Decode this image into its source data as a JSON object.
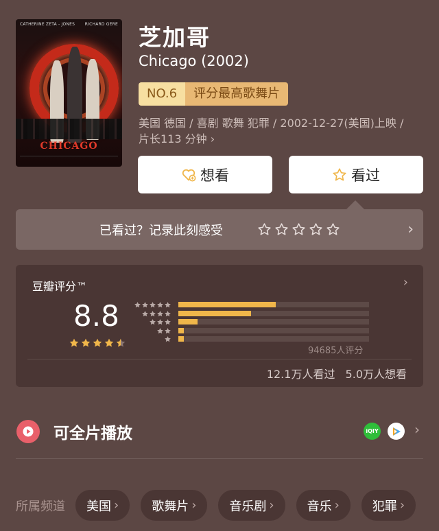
{
  "movie": {
    "title_cn": "芝加哥",
    "title_en": "Chicago (2002)",
    "rank_no": "NO.6",
    "rank_label": "评分最高歌舞片",
    "meta_line1": "美国 德国 / 喜剧 歌舞 犯罪 / 2002-12-27(美国)上映 /",
    "meta_line2": "片长113 分钟",
    "poster": {
      "actor_left": "CATHERINE ZETA - JONES",
      "actor_right": "RICHARD GERE",
      "logo": "CHICAGO"
    }
  },
  "actions": {
    "want_label": "想看",
    "seen_label": "看过"
  },
  "record": {
    "prompt": "已看过？记录此刻感受"
  },
  "rating": {
    "title": "豆瓣评分™",
    "score": "8.8",
    "stars": 4.5,
    "distribution": [
      0.51,
      0.38,
      0.1,
      0.03,
      0.03
    ],
    "count_text": "94685人评分",
    "watched_text": "12.1万人看过",
    "wish_text": "5.0万人想看"
  },
  "play": {
    "label": "可全片播放",
    "iqiyi_text": "iQIY"
  },
  "channels": {
    "label": "所属频道",
    "items": [
      "美国",
      "歌舞片",
      "音乐剧",
      "音乐",
      "犯罪"
    ]
  },
  "colors": {
    "background": "#5c4744",
    "accent_gold": "#f0b64a",
    "play_red": "#e9606a"
  }
}
